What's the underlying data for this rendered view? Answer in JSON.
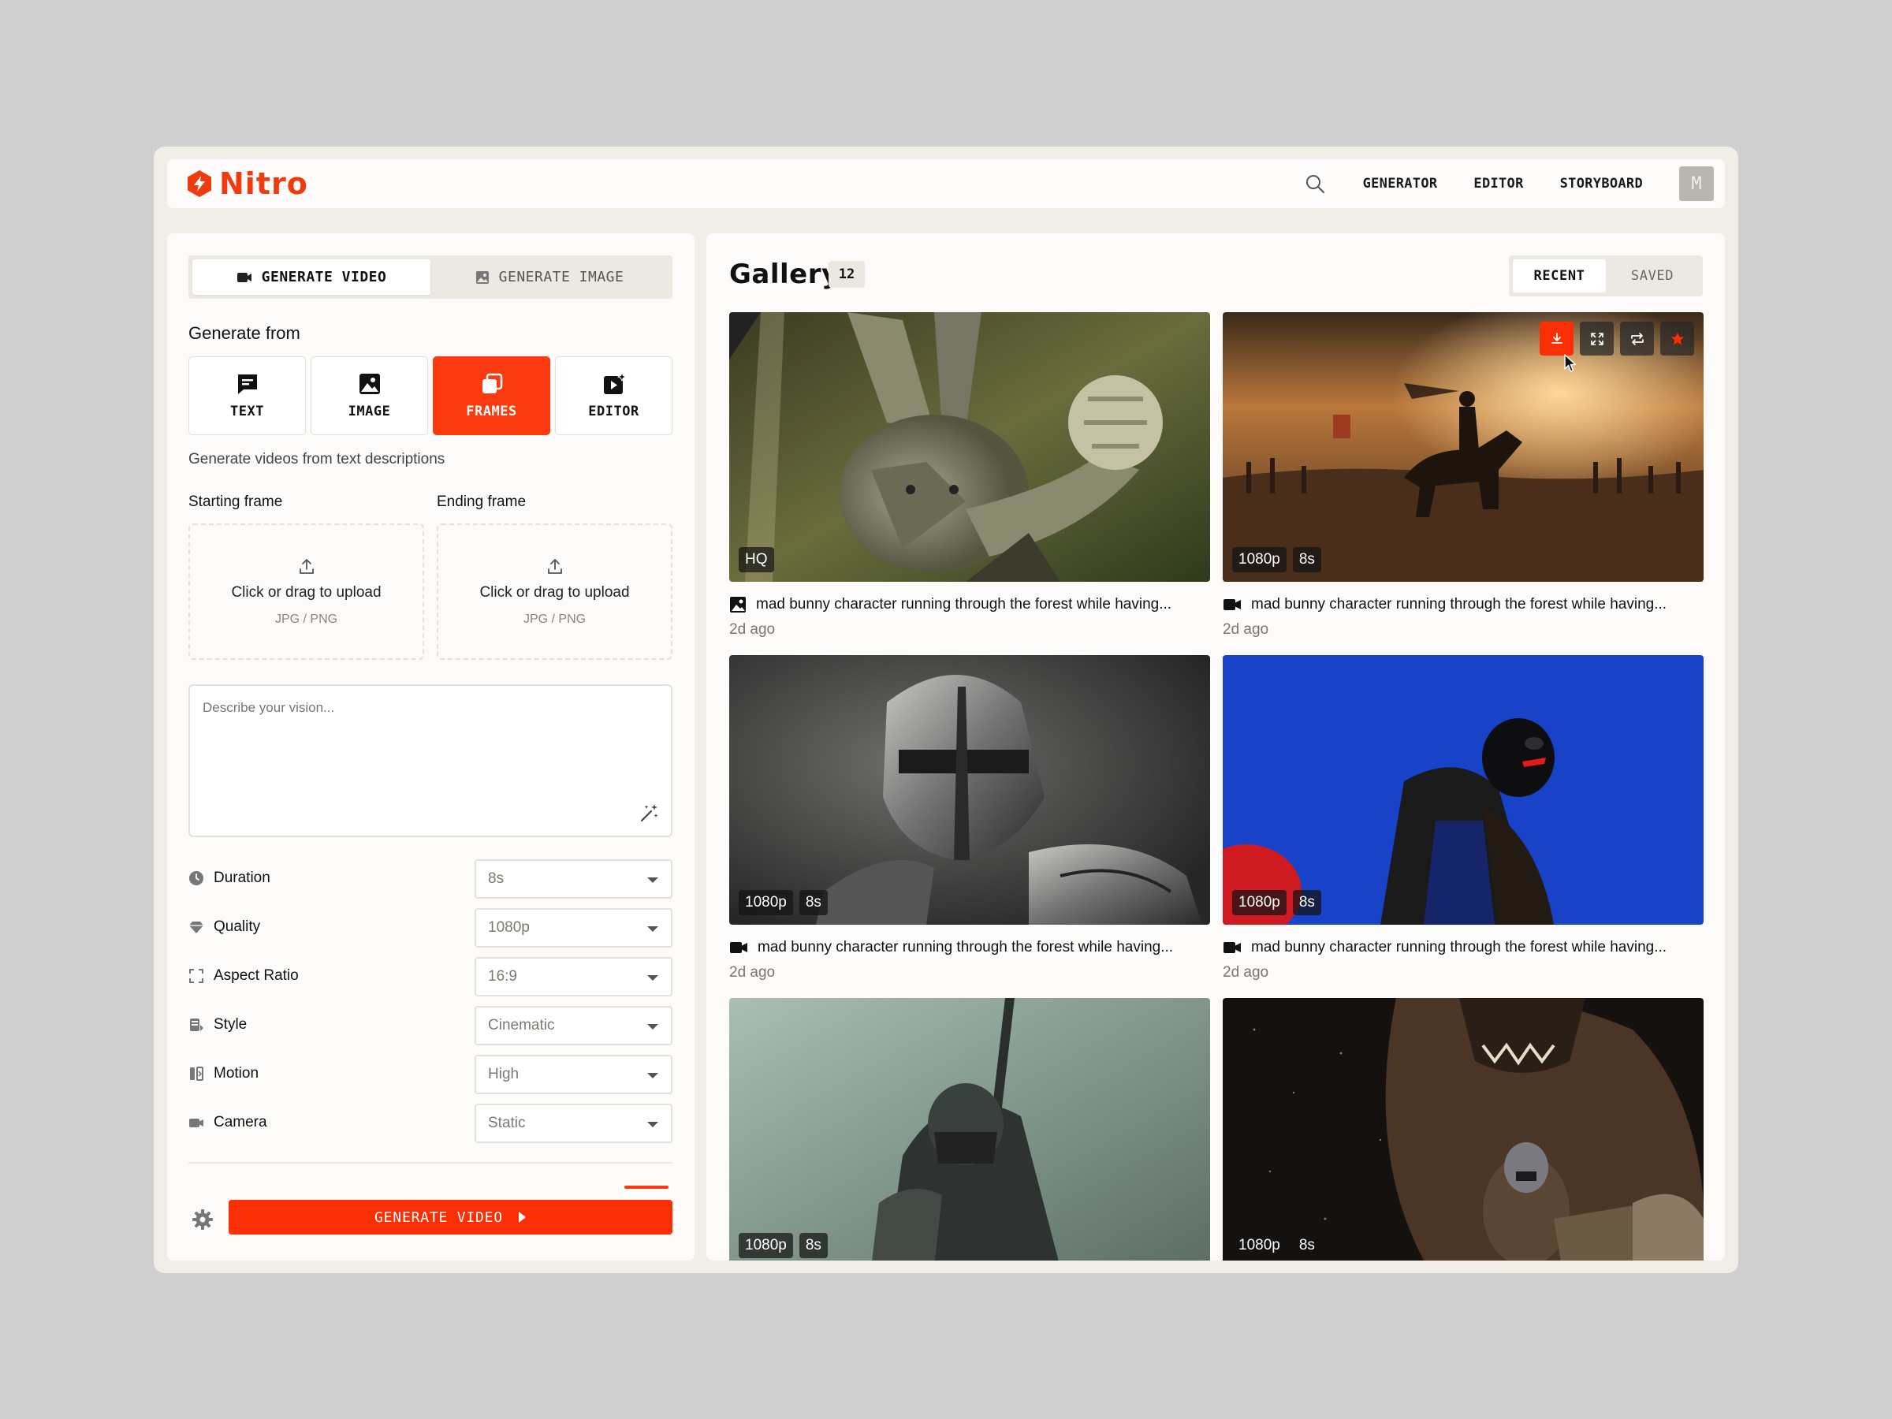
{
  "brand": {
    "name": "Nitro",
    "accent": "#fb3a0f"
  },
  "header": {
    "nav": [
      "GENERATOR",
      "EDITOR",
      "STORYBOARD"
    ],
    "avatar_initial": "M"
  },
  "mode_tabs": {
    "video": "GENERATE VIDEO",
    "image": "GENERATE IMAGE",
    "active": "video"
  },
  "generate_from": {
    "title": "Generate from",
    "options": [
      "TEXT",
      "IMAGE",
      "FRAMES",
      "EDITOR"
    ],
    "active": "FRAMES",
    "description": "Generate videos from text descriptions"
  },
  "frames": {
    "start_label": "Starting frame",
    "end_label": "Ending frame",
    "upload_text": "Click or drag to upload",
    "upload_formats": "JPG / PNG"
  },
  "prompt": {
    "placeholder": "Describe your vision..."
  },
  "settings": [
    {
      "label": "Duration",
      "value": "8s",
      "icon": "clock-icon"
    },
    {
      "label": "Quality",
      "value": "1080p",
      "icon": "diamond-icon"
    },
    {
      "label": "Aspect Ratio",
      "value": "16:9",
      "icon": "aspect-ratio-icon"
    },
    {
      "label": "Style",
      "value": "Cinematic",
      "icon": "style-icon"
    },
    {
      "label": "Motion",
      "value": "High",
      "icon": "motion-icon"
    },
    {
      "label": "Camera",
      "value": "Static",
      "icon": "camera-icon"
    }
  ],
  "generate_button": "GENERATE VIDEO",
  "gallery": {
    "title": "Gallery",
    "count": "12",
    "tabs": [
      "RECENT",
      "SAVED"
    ],
    "active_tab": "RECENT",
    "items": [
      {
        "badges": [
          "HQ"
        ],
        "type": "image",
        "caption": "mad bunny character running through the forest while having...",
        "time": "2d ago"
      },
      {
        "badges": [
          "1080p",
          "8s"
        ],
        "type": "video",
        "caption": "mad bunny character running through the forest while having...",
        "time": "2d ago"
      },
      {
        "badges": [
          "1080p",
          "8s"
        ],
        "type": "video",
        "caption": "mad bunny character running through the forest while having...",
        "time": "2d ago"
      },
      {
        "badges": [
          "1080p",
          "8s"
        ],
        "type": "video",
        "caption": "mad bunny character running through the forest while having...",
        "time": "2d ago"
      },
      {
        "badges": [
          "1080p",
          "8s"
        ],
        "type": "video"
      },
      {
        "badges": [
          "1080p",
          "8s"
        ],
        "type": "video"
      }
    ]
  }
}
